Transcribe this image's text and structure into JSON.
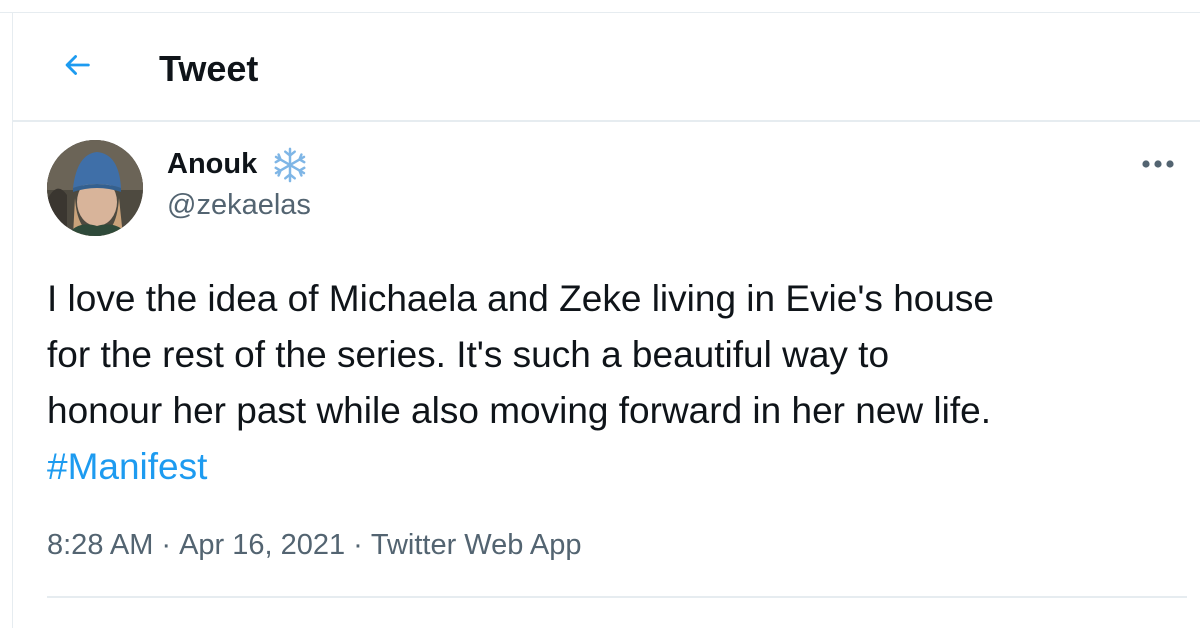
{
  "header": {
    "title": "Tweet",
    "back_icon": "arrow-left-icon"
  },
  "tweet": {
    "author": {
      "display_name": "Anouk",
      "emoji": "snowflake-icon",
      "handle": "@zekaelas"
    },
    "text_lines": [
      "I love the idea of Michaela and Zeke living in Evie's house",
      "for the rest of the series. It's such a beautiful way to",
      "honour her past while also moving forward in her new life."
    ],
    "hashtag": "#Manifest",
    "time": "8:28 AM",
    "date": "Apr 16, 2021",
    "separator": "·",
    "source": "Twitter Web App",
    "more_icon": "more-options-icon"
  },
  "colors": {
    "accent": "#1d9bf0",
    "text_primary": "#0f1419",
    "text_secondary": "#536471",
    "divider": "#e6ecf0"
  }
}
